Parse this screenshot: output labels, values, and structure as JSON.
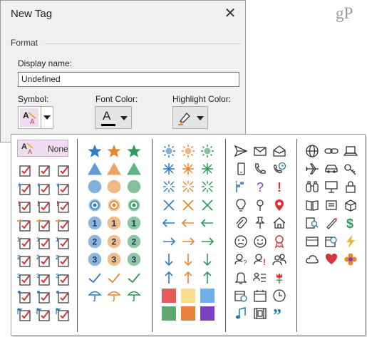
{
  "dialog": {
    "title": "New Tag",
    "close_glyph": "✕",
    "format_group": "Format",
    "display_name_label": "Display name:",
    "display_name_value": "Undefined",
    "symbol_label": "Symbol:",
    "font_color_label": "Font Color:",
    "highlight_color_label": "Highlight Color:",
    "font_color_glyph": "A",
    "font_color_value": "#000000"
  },
  "symbol_panel": {
    "none_label": "None",
    "columns": [
      {
        "name": "checkboxes",
        "icons": [
          "checkbox-checked",
          "checkbox-checked",
          "checkbox-checked",
          "checkbox-star",
          "checkbox-star",
          "checkbox-star",
          "checkbox-exclamation",
          "checkbox-exclamation",
          "checkbox-exclamation",
          "checkbox-arrow-right",
          "checkbox-arrow-right",
          "checkbox-arrow-right",
          "checkbox-1",
          "checkbox-1",
          "checkbox-1",
          "checkbox-2",
          "checkbox-2",
          "checkbox-2",
          "checkbox-3",
          "checkbox-3",
          "checkbox-3",
          "checkbox-person",
          "checkbox-person",
          "checkbox-person",
          "checkbox-flag",
          "checkbox-flag",
          "checkbox-flag"
        ]
      },
      {
        "name": "shapes",
        "icons": [
          "star-blue",
          "star-orange",
          "star-green",
          "triangle-blue",
          "triangle-orange",
          "triangle-green",
          "circle-blue",
          "circle-orange",
          "circle-green",
          "ring-blue",
          "ring-orange",
          "ring-green",
          "circle-1-blue",
          "circle-1-orange",
          "circle-1-green",
          "circle-2-blue",
          "circle-2-orange",
          "circle-2-green",
          "circle-3-blue",
          "circle-3-orange",
          "circle-3-green",
          "check-blue",
          "check-orange",
          "check-green",
          "umbrella-blue",
          "umbrella-orange",
          "umbrella-green"
        ]
      },
      {
        "name": "arrows",
        "icons": [
          "sun-blue",
          "sun-orange",
          "sun-green",
          "asterisk-blue",
          "asterisk-orange",
          "asterisk-green",
          "burst-blue",
          "burst-orange",
          "burst-green",
          "cross-blue",
          "cross-orange",
          "cross-green",
          "arrow-left-blue",
          "arrow-left-orange",
          "arrow-left-green",
          "arrow-right-blue",
          "arrow-right-orange",
          "arrow-right-green",
          "arrow-down-blue",
          "arrow-down-orange",
          "arrow-down-green",
          "arrow-up-blue",
          "arrow-up-orange",
          "arrow-up-green",
          "square-red",
          "square-yellow",
          "square-blue",
          "square-green",
          "square-orange",
          "square-purple"
        ]
      },
      {
        "name": "communication",
        "icons": [
          "send-icon",
          "mail-icon",
          "mail-open-icon",
          "mobile-icon",
          "phone-icon",
          "phone-clock-icon",
          "flag-icon",
          "question-icon",
          "exclamation-icon",
          "lightbulb-icon",
          "pin-icon",
          "pin-red-icon",
          "paperclip-icon",
          "pushpin-icon",
          "home-icon",
          "frown-icon",
          "smile-icon",
          "ribbon-icon",
          "contact-question-icon",
          "contact-exclamation-icon",
          "people-icon",
          "bell-icon",
          "list-person-icon",
          "flower-icon",
          "calendar-clock-icon",
          "calendar-icon",
          "clock-icon",
          "music-note-icon",
          "film-icon",
          "quote-icon"
        ]
      },
      {
        "name": "misc",
        "icons": [
          "globe-icon",
          "link-icon",
          "laptop-icon",
          "airplane-icon",
          "car-icon",
          "key-icon",
          "binoculars-icon",
          "presentation-icon",
          "lock-icon",
          "book-open-icon",
          "envelope-open-icon",
          "box-icon",
          "book-search-icon",
          "pencil-icon",
          "dollar-icon",
          "card-icon",
          "calendar-clock-icon-2",
          "lightning-icon",
          "cloud-icon",
          "heart-icon",
          "flower-orange-icon"
        ]
      }
    ]
  },
  "watermark": "gP",
  "colors": {
    "blue": "#2e7cc4",
    "orange": "#e8862e",
    "green": "#2e9b58",
    "red": "#d4343a",
    "purple": "#7b3fc7",
    "dark": "#333333",
    "teal": "#1f7aa8",
    "highlight_pink": "#eedcef"
  }
}
